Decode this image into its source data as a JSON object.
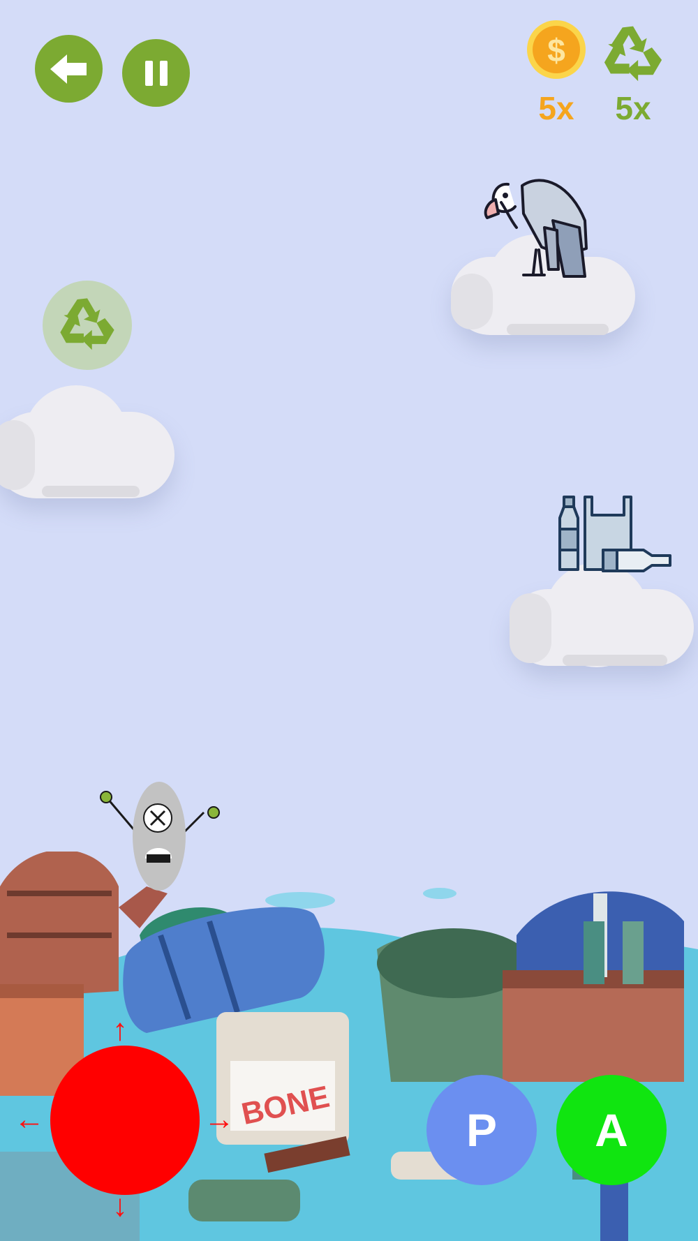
{
  "hud": {
    "back_icon": "back-arrow-icon",
    "pause_icon": "pause-icon",
    "coins": {
      "icon": "dollar-coin-icon",
      "count": "5x",
      "color": "#f5a51e"
    },
    "recycle": {
      "icon": "recycle-icon",
      "count": "5x",
      "color": "#7caa32"
    }
  },
  "scene": {
    "enemy": "vulture-icon",
    "pickup": "recycle-token-icon",
    "trash": "plastic-trash-icon",
    "player": "robot-character",
    "junk_sign": "BONE"
  },
  "controls": {
    "joystick_color": "#ff0000",
    "p_label": "P",
    "p_color": "#6b8ff0",
    "a_label": "A",
    "a_color": "#10e510"
  }
}
